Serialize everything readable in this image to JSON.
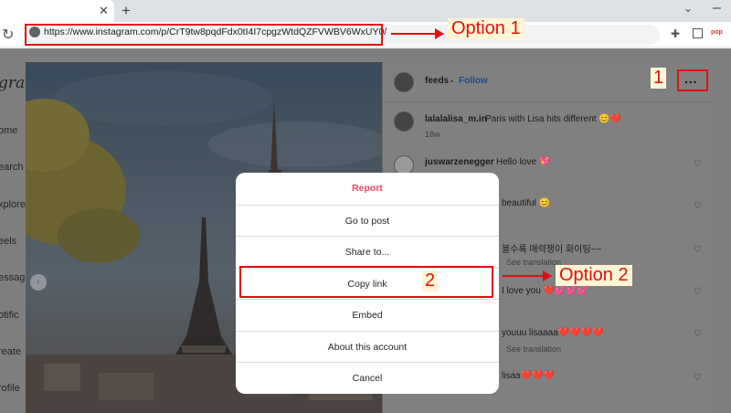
{
  "browser": {
    "tab_close_icon": "close-icon",
    "new_tab_icon": "plus-icon",
    "url": "https://www.instagram.com/p/CrT9tw8pqdFdx0tI4I7cpgzWtdQZFVWBV6WxUY0/",
    "extension_label": "pop"
  },
  "annotations": {
    "option1": "Option 1",
    "option2": "Option 2",
    "step1": "1",
    "step2": "2"
  },
  "left_nav": {
    "logo": "gram",
    "items": [
      "ome",
      "earch",
      "xplore",
      "eels",
      "essag",
      "otific",
      "reate",
      "rofile"
    ]
  },
  "post": {
    "header": {
      "username": "feeds",
      "separator": "•",
      "follow_label": "Follow",
      "more_label": "..."
    },
    "caption": {
      "username": "lalalalisa_m.in",
      "text": "Paris with Lisa hits different 😊❤️",
      "time": "18w"
    },
    "comments": [
      {
        "username": "juswarzenegger",
        "text": "Hello love 💖",
        "meta": ""
      },
      {
        "username": "",
        "text": "beautiful 😊",
        "meta": ""
      },
      {
        "username": "",
        "text": "볼수록 매력쟁이 화이팅~~",
        "meta": "See translation"
      },
      {
        "username": "",
        "text": "I love you ❤️💕💕💕",
        "meta": ""
      },
      {
        "username": "",
        "text": "youuu lisaaaa❤️❤️❤️❤️",
        "meta": "See translation"
      },
      {
        "username": "",
        "text": "lisaa❤️❤️❤️",
        "meta": ""
      }
    ]
  },
  "modal": {
    "items": [
      "Report",
      "Go to post",
      "Share to...",
      "Copy link",
      "Embed",
      "About this account",
      "Cancel"
    ]
  },
  "colors": {
    "accent": "#e01010",
    "report": "#ed4956",
    "follow": "#0095f6"
  }
}
